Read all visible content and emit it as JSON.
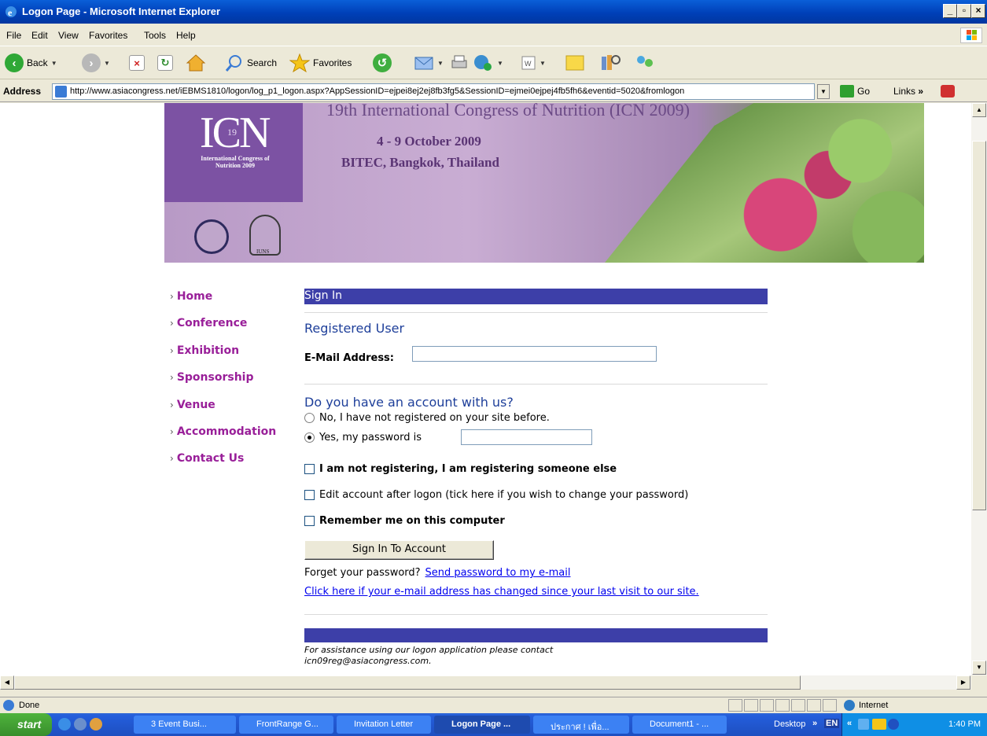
{
  "window": {
    "title": "Logon Page - Microsoft Internet Explorer"
  },
  "menu": [
    "File",
    "Edit",
    "View",
    "Favorites",
    "Tools",
    "Help"
  ],
  "toolbar": {
    "back": "Back",
    "search": "Search",
    "favorites": "Favorites"
  },
  "address": {
    "label": "Address",
    "url": "http://www.asiacongress.net/iEBMS1810/logon/log_p1_logon.aspx?AppSessionID=ejpei8ej2ej8fb3fg5&SessionID=ejmei0ejpej4fb5fh6&eventid=5020&fromlogon",
    "go": "Go",
    "links": "Links"
  },
  "banner": {
    "logo_text": "ICN",
    "logo_sup": "19",
    "logo_sub": "International Congress of Nutrition 2009",
    "congress": "19th International Congress of Nutrition (ICN 2009)",
    "dates": "4 - 9 October 2009",
    "venue": "BITEC, Bangkok, Thailand",
    "seal_label": "IUNS"
  },
  "nav": [
    "Home",
    "Conference",
    "Exhibition",
    "Sponsorship",
    "Venue",
    "Accommodation",
    "Contact Us"
  ],
  "form": {
    "signin_header": "Sign In",
    "registered_heading": "Registered User",
    "email_label": "E-Mail Address:",
    "email_value": "",
    "account_heading": "Do you have an account with us?",
    "radio_no": "No, I have not registered on your site before.",
    "radio_yes": "Yes, my password is",
    "radio_selected": "yes",
    "password_value": "",
    "cb_someone_else": "I am not registering, I am registering someone else",
    "cb_edit_account": "Edit account after logon (tick here if you wish to change your password)",
    "cb_remember": "Remember me on this computer",
    "signin_button": "Sign In To Account",
    "forget_prefix": "Forget your password?",
    "forget_link": "Send password to my e-mail",
    "changed_email_link": "Click here if your e-mail address has changed since your last visit to our site.",
    "assistance_line1": "For assistance using our logon application please contact",
    "assistance_line2": "icn09reg@asiacongress.com."
  },
  "status": {
    "left": "Done",
    "zone": "Internet"
  },
  "taskbar": {
    "start": "start",
    "tasks": [
      "3 Event Busi...",
      "FrontRange G...",
      "Invitation Letter",
      "Logon Page ...",
      "ประกาศ ! เพื่อ...",
      "Document1 - ..."
    ],
    "desktop": "Desktop",
    "lang": "EN",
    "clock": "1:40 PM"
  },
  "colors": {
    "nav_link": "#991F99",
    "form_bar": "#3D3FA8",
    "heading": "#1E3F9A",
    "link": "#0000EE"
  }
}
